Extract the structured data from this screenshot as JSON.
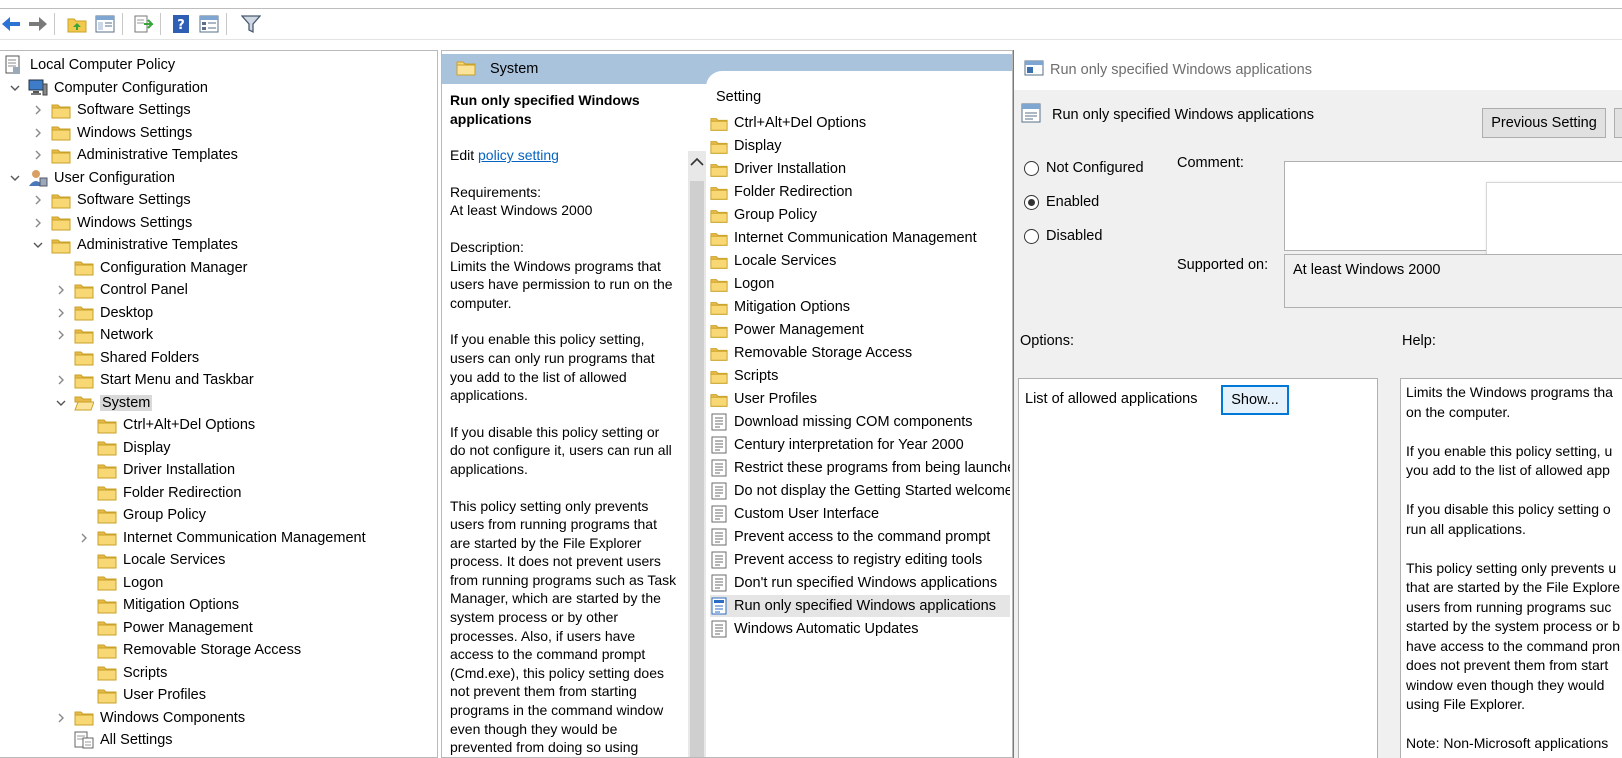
{
  "colors": {
    "accent": "#0078d7",
    "folder": "#f8d775",
    "header_blue": "#aac3dd",
    "link": "#0563c1"
  },
  "toolbar": {
    "icons": [
      "back-arrow-icon",
      "forward-arrow-icon",
      "up-folder-icon",
      "show-hide-tree-icon",
      "export-list-icon",
      "help-icon",
      "properties-icon",
      "filter-icon"
    ]
  },
  "tree": {
    "items": [
      {
        "label": "Local Computer Policy",
        "icon": "policy-icon",
        "level": 0,
        "twisty": "none"
      },
      {
        "label": "Computer Configuration",
        "icon": "computer-icon",
        "level": 1,
        "twisty": "open"
      },
      {
        "label": "Software Settings",
        "icon": "folder-icon",
        "level": 2,
        "twisty": "closed"
      },
      {
        "label": "Windows Settings",
        "icon": "folder-icon",
        "level": 2,
        "twisty": "closed"
      },
      {
        "label": "Administrative Templates",
        "icon": "folder-icon",
        "level": 2,
        "twisty": "closed"
      },
      {
        "label": "User Configuration",
        "icon": "user-icon",
        "level": 1,
        "twisty": "open"
      },
      {
        "label": "Software Settings",
        "icon": "folder-icon",
        "level": 2,
        "twisty": "closed"
      },
      {
        "label": "Windows Settings",
        "icon": "folder-icon",
        "level": 2,
        "twisty": "closed"
      },
      {
        "label": "Administrative Templates",
        "icon": "folder-icon",
        "level": 2,
        "twisty": "open"
      },
      {
        "label": "Configuration Manager",
        "icon": "folder-icon",
        "level": 3,
        "twisty": "none"
      },
      {
        "label": "Control Panel",
        "icon": "folder-icon",
        "level": 3,
        "twisty": "closed"
      },
      {
        "label": "Desktop",
        "icon": "folder-icon",
        "level": 3,
        "twisty": "closed"
      },
      {
        "label": "Network",
        "icon": "folder-icon",
        "level": 3,
        "twisty": "closed"
      },
      {
        "label": "Shared Folders",
        "icon": "folder-icon",
        "level": 3,
        "twisty": "none"
      },
      {
        "label": "Start Menu and Taskbar",
        "icon": "folder-icon",
        "level": 3,
        "twisty": "closed"
      },
      {
        "label": "System",
        "icon": "folder-open-icon",
        "level": 3,
        "twisty": "open",
        "selected": true
      },
      {
        "label": "Ctrl+Alt+Del Options",
        "icon": "folder-icon",
        "level": 4,
        "twisty": "none"
      },
      {
        "label": "Display",
        "icon": "folder-icon",
        "level": 4,
        "twisty": "none"
      },
      {
        "label": "Driver Installation",
        "icon": "folder-icon",
        "level": 4,
        "twisty": "none"
      },
      {
        "label": "Folder Redirection",
        "icon": "folder-icon",
        "level": 4,
        "twisty": "none"
      },
      {
        "label": "Group Policy",
        "icon": "folder-icon",
        "level": 4,
        "twisty": "none"
      },
      {
        "label": "Internet Communication Management",
        "icon": "folder-icon",
        "level": 4,
        "twisty": "closed"
      },
      {
        "label": "Locale Services",
        "icon": "folder-icon",
        "level": 4,
        "twisty": "none"
      },
      {
        "label": "Logon",
        "icon": "folder-icon",
        "level": 4,
        "twisty": "none"
      },
      {
        "label": "Mitigation Options",
        "icon": "folder-icon",
        "level": 4,
        "twisty": "none"
      },
      {
        "label": "Power Management",
        "icon": "folder-icon",
        "level": 4,
        "twisty": "none"
      },
      {
        "label": "Removable Storage Access",
        "icon": "folder-icon",
        "level": 4,
        "twisty": "none"
      },
      {
        "label": "Scripts",
        "icon": "folder-icon",
        "level": 4,
        "twisty": "none"
      },
      {
        "label": "User Profiles",
        "icon": "folder-icon",
        "level": 4,
        "twisty": "none"
      },
      {
        "label": "Windows Components",
        "icon": "folder-icon",
        "level": 3,
        "twisty": "closed"
      },
      {
        "label": "All Settings",
        "icon": "all-settings-icon",
        "level": 3,
        "twisty": "none"
      }
    ]
  },
  "middle": {
    "header_title": "System",
    "ext": {
      "title": "Run only specified Windows applications",
      "edit_prefix": "Edit",
      "edit_link": "policy setting",
      "requirements_label": "Requirements:",
      "requirements_value": "At least Windows 2000",
      "description_label": "Description:",
      "description_paragraphs": [
        "Limits the Windows programs that users have permission to run on the computer.",
        "If you enable this policy setting, users can only run programs that you add to the list of allowed applications.",
        "If you disable this policy setting or do not configure it, users can run all applications.",
        "This policy setting only prevents users from running programs that are started by the File Explorer process.  It does not prevent users from running programs such as Task Manager, which are started by the system process or by other processes.  Also, if users have access to the command prompt (Cmd.exe), this policy setting does not prevent them from starting programs in the command window even though they would be prevented from doing so using"
      ]
    },
    "list_header": "Setting",
    "list_items": [
      {
        "label": "Ctrl+Alt+Del Options",
        "icon": "folder-icon"
      },
      {
        "label": "Display",
        "icon": "folder-icon"
      },
      {
        "label": "Driver Installation",
        "icon": "folder-icon"
      },
      {
        "label": "Folder Redirection",
        "icon": "folder-icon"
      },
      {
        "label": "Group Policy",
        "icon": "folder-icon"
      },
      {
        "label": "Internet Communication Management",
        "icon": "folder-icon"
      },
      {
        "label": "Locale Services",
        "icon": "folder-icon"
      },
      {
        "label": "Logon",
        "icon": "folder-icon"
      },
      {
        "label": "Mitigation Options",
        "icon": "folder-icon"
      },
      {
        "label": "Power Management",
        "icon": "folder-icon"
      },
      {
        "label": "Removable Storage Access",
        "icon": "folder-icon"
      },
      {
        "label": "Scripts",
        "icon": "folder-icon"
      },
      {
        "label": "User Profiles",
        "icon": "folder-icon"
      },
      {
        "label": "Download missing COM components",
        "icon": "policy-setting-icon"
      },
      {
        "label": "Century interpretation for Year 2000",
        "icon": "policy-setting-icon"
      },
      {
        "label": "Restrict these programs from being launched",
        "icon": "policy-setting-icon"
      },
      {
        "label": "Do not display the Getting Started welcome screen at logon",
        "icon": "policy-setting-icon"
      },
      {
        "label": "Custom User Interface",
        "icon": "policy-setting-icon"
      },
      {
        "label": "Prevent access to the command prompt",
        "icon": "policy-setting-icon"
      },
      {
        "label": "Prevent access to registry editing tools",
        "icon": "policy-setting-icon"
      },
      {
        "label": "Don't run specified Windows applications",
        "icon": "policy-setting-icon"
      },
      {
        "label": "Run only specified Windows applications",
        "icon": "policy-setting-selected-icon",
        "selected": true
      },
      {
        "label": "Windows Automatic Updates",
        "icon": "policy-setting-icon"
      }
    ]
  },
  "dialog": {
    "window_title": "Run only specified Windows applications",
    "subtitle": "Run only specified Windows applications",
    "prev_button": "Previous Setting",
    "radios": [
      {
        "label": "Not Configured",
        "checked": false
      },
      {
        "label": "Enabled",
        "checked": true
      },
      {
        "label": "Disabled",
        "checked": false
      }
    ],
    "comment_label": "Comment:",
    "supported_label": "Supported on:",
    "supported_value": "At least Windows 2000",
    "options_label": "Options:",
    "help_label": "Help:",
    "option_list_label": "List of allowed applications",
    "show_button": "Show...",
    "help_lines": [
      [
        "Limits the Windows programs tha",
        "on the computer."
      ],
      [
        "If you enable this policy setting, u",
        "you add to the list of allowed app"
      ],
      [
        "If you disable this policy setting o",
        "run all applications."
      ],
      [
        "This policy setting only prevents u",
        "that are started by the File Explore",
        "users from running programs suc",
        "started by the system process or b",
        "have access to the command pron",
        "does not prevent them from start",
        "window even though they would",
        "using File Explorer."
      ],
      [
        "Note: Non-Microsoft applications"
      ]
    ]
  }
}
